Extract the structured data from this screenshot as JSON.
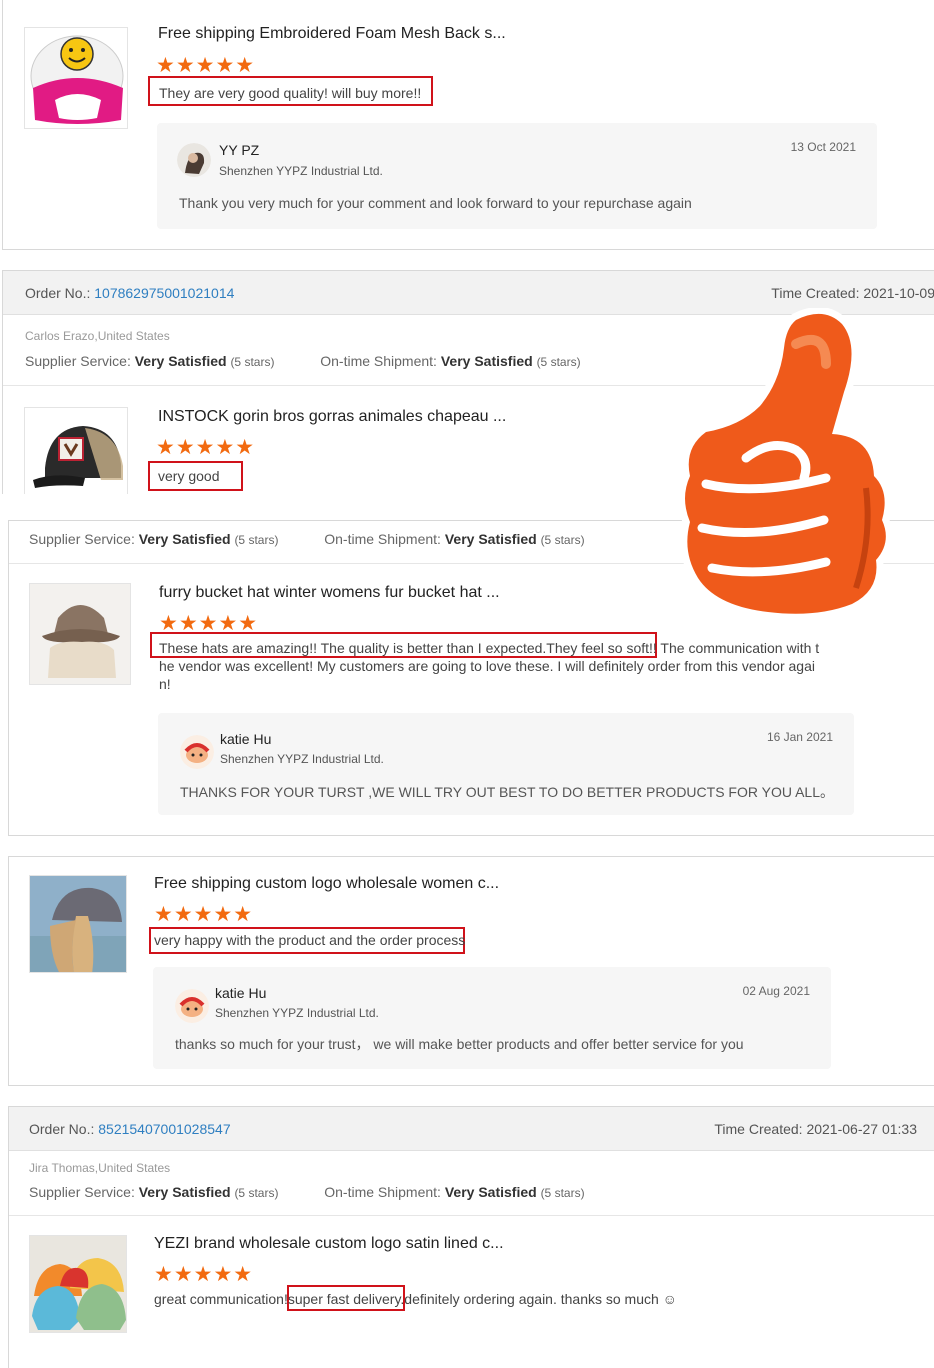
{
  "colors": {
    "star": "#f26a10",
    "highlight_box": "#d0121a",
    "order_link": "#2f7fc1",
    "thumbs_up": "#ef5a1b"
  },
  "icons": {
    "star": "star-icon",
    "thumbs_up": "thumbs-up-icon",
    "smiley": "smiley-icon"
  },
  "stars_glyph": "★★★★★",
  "review1": {
    "product_title": "Free shipping Embroidered Foam Mesh Back s...",
    "rating": 5,
    "comment": "They are very good quality! will buy more!!",
    "reply": {
      "name": "YY PZ",
      "company": "Shenzhen YYPZ Industrial Ltd.",
      "date": "13 Oct 2021",
      "text": "Thank you very much for your comment and look forward to your repurchase again"
    }
  },
  "order1": {
    "order_label": "Order No.:",
    "order_number": "107862975001021014",
    "time_label": "Time Created:",
    "time_value": "2021-10-09",
    "buyer": "Carlos Erazo,United States",
    "supplier_service_label": "Supplier Service:",
    "supplier_service_value": "Very Satisfied",
    "supplier_service_stars": "(5 stars)",
    "shipment_label": "On-time Shipment:",
    "shipment_value": "Very Satisfied",
    "shipment_stars": "(5 stars)",
    "product_title": "INSTOCK gorin bros gorras animales chapeau ...",
    "rating": 5,
    "comment": "very good"
  },
  "review3": {
    "supplier_service_label": "Supplier Service:",
    "supplier_service_value": "Very Satisfied",
    "supplier_service_stars": "(5 stars)",
    "shipment_label": "On-time Shipment:",
    "shipment_value": "Very Satisfied",
    "shipment_stars": "(5 stars)",
    "product_title": "furry bucket hat winter womens fur bucket hat ...",
    "rating": 5,
    "comment_line1": "These hats are amazing!! The quality is better than I expected.They feel so soft!! The communication with t",
    "comment_line2": "he vendor was excellent! My customers are going to love these. I will definitely order from this vendor agai",
    "comment_line3": "n!",
    "reply": {
      "name": "katie Hu",
      "company": "Shenzhen YYPZ Industrial Ltd.",
      "date": "16 Jan 2021",
      "text": "THANKS FOR YOUR TURST ,WE WILL TRY OUT BEST TO DO BETTER PRODUCTS FOR YOU ALL。"
    }
  },
  "review4": {
    "product_title": "Free shipping custom logo wholesale women c...",
    "rating": 5,
    "comment": "very happy with the product and the order process",
    "reply": {
      "name": "katie Hu",
      "company": "Shenzhen YYPZ Industrial Ltd.",
      "date": "02 Aug 2021",
      "text": "thanks so much for your trust， we will make better products and offer better service for you"
    }
  },
  "order2": {
    "order_label": "Order No.:",
    "order_number": "85215407001028547",
    "time_label": "Time Created:",
    "time_value": "2021-06-27 01:33",
    "buyer": "Jira Thomas,United States",
    "supplier_service_label": "Supplier Service:",
    "supplier_service_value": "Very Satisfied",
    "supplier_service_stars": "(5 stars)",
    "shipment_label": "On-time Shipment:",
    "shipment_value": "Very Satisfied",
    "shipment_stars": "(5 stars)",
    "product_title": "YEZI brand wholesale custom logo satin lined c...",
    "rating": 5,
    "comment_pre": "great communication!",
    "comment_highlight": "super fast delivery",
    "comment_post": ".definitely ordering again. thanks so much ☺"
  }
}
